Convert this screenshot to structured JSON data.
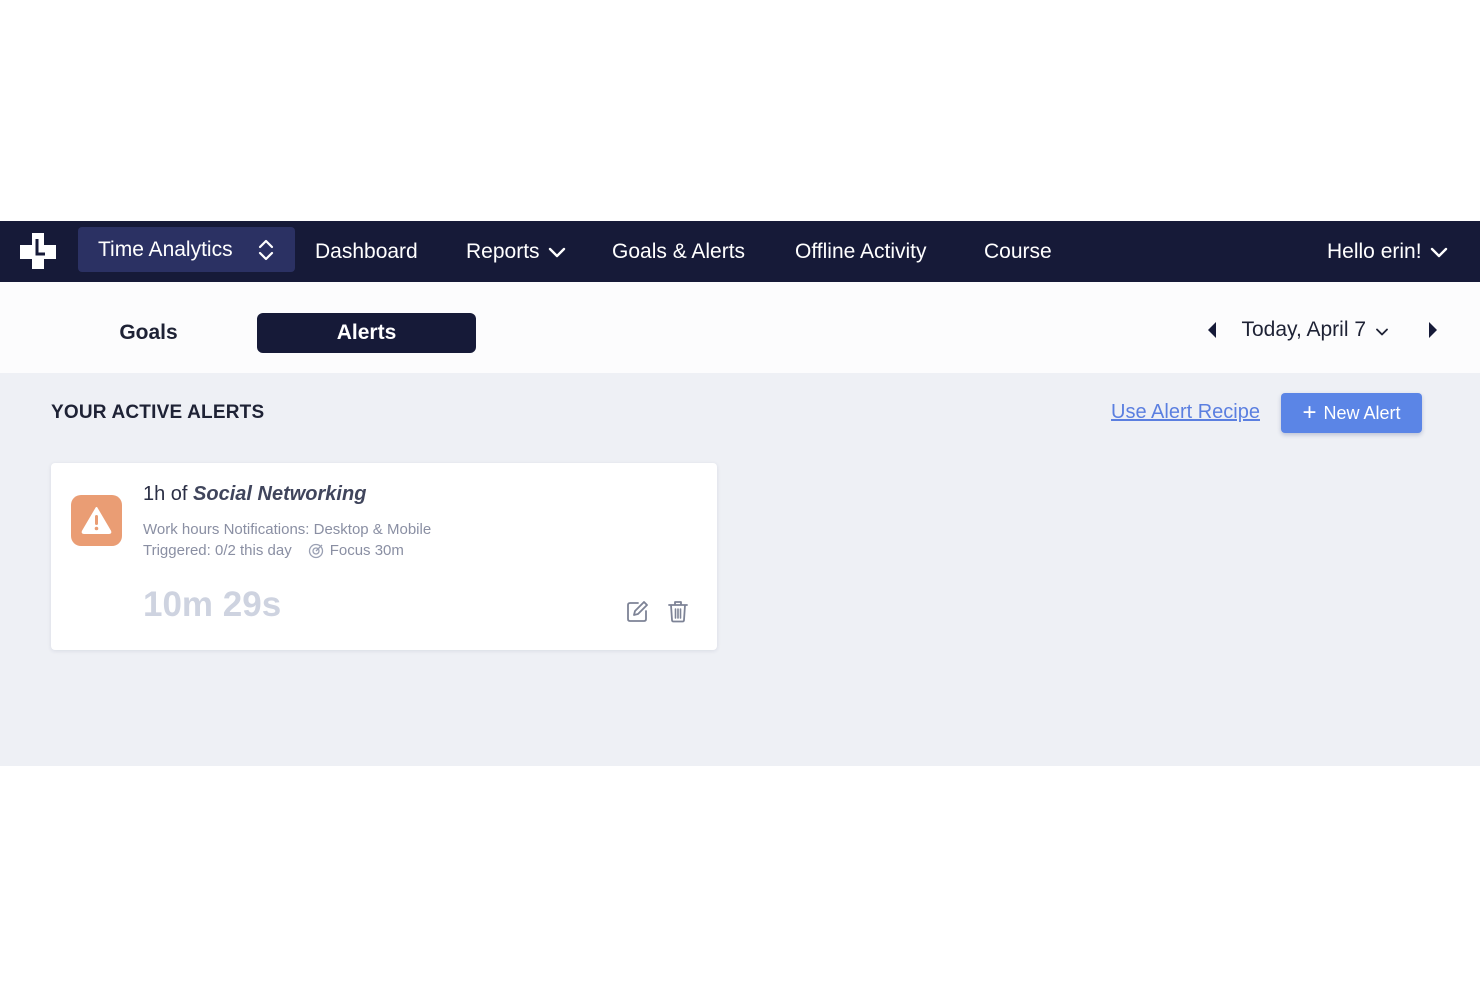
{
  "nav": {
    "switcher_label": "Time Analytics",
    "items": [
      {
        "label": "Dashboard"
      },
      {
        "label": "Reports"
      },
      {
        "label": "Goals & Alerts"
      },
      {
        "label": "Offline Activity"
      },
      {
        "label": "Course"
      }
    ],
    "user_greeting": "Hello erin!"
  },
  "tabs": {
    "goals": "Goals",
    "alerts": "Alerts",
    "active": "Alerts"
  },
  "date_nav": {
    "label": "Today, April 7"
  },
  "content": {
    "section_title": "YOUR ACTIVE ALERTS",
    "recipe_link": "Use Alert Recipe",
    "new_alert_label": "New Alert"
  },
  "alerts": [
    {
      "title_prefix": "1h of",
      "category": "Social Networking",
      "schedule_notifications": "Work hours Notifications: Desktop & Mobile",
      "triggered": "Triggered: 0/2 this day",
      "focus": "Focus 30m",
      "elapsed": "10m 29s",
      "icon": "warning-icon"
    }
  ],
  "colors": {
    "nav_bg": "#161a38",
    "switcher_bg": "#2b3163",
    "accent": "#5b85e6",
    "link": "#5b7fe0",
    "warning": "#ea9d74",
    "page_bg": "#eef0f5"
  }
}
